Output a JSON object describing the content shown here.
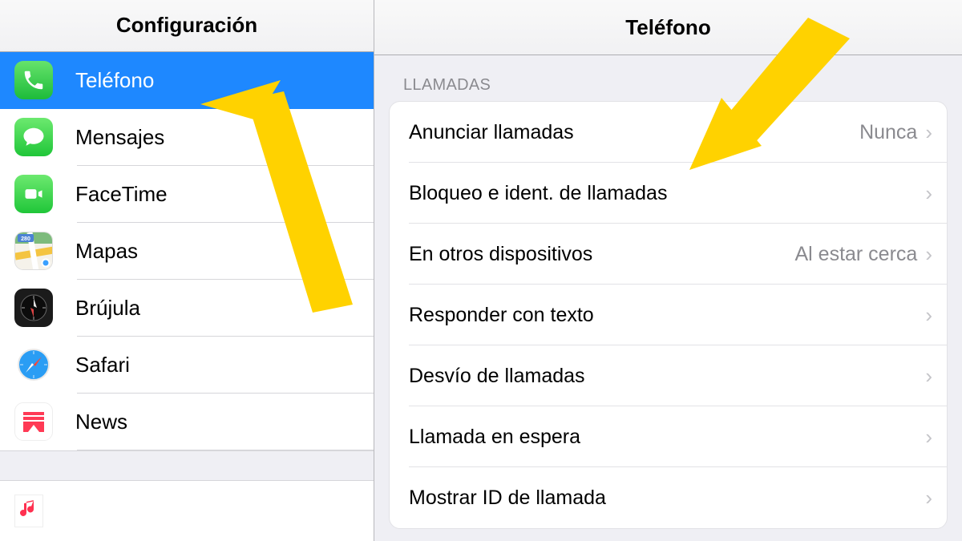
{
  "left": {
    "header": "Configuración",
    "items": [
      {
        "icon": "phone",
        "label": "Teléfono",
        "selected": true
      },
      {
        "icon": "messages",
        "label": "Mensajes"
      },
      {
        "icon": "facetime",
        "label": "FaceTime"
      },
      {
        "icon": "maps",
        "label": "Mapas"
      },
      {
        "icon": "compass",
        "label": "Brújula"
      },
      {
        "icon": "safari",
        "label": "Safari"
      },
      {
        "icon": "news",
        "label": "News"
      }
    ]
  },
  "right": {
    "header": "Teléfono",
    "section_label": "LLAMADAS",
    "rows": [
      {
        "label": "Anunciar llamadas",
        "value": "Nunca"
      },
      {
        "label": "Bloqueo e ident. de llamadas",
        "value": ""
      },
      {
        "label": "En otros dispositivos",
        "value": "Al estar cerca"
      },
      {
        "label": "Responder con texto",
        "value": ""
      },
      {
        "label": "Desvío de llamadas",
        "value": ""
      },
      {
        "label": "Llamada en espera",
        "value": ""
      },
      {
        "label": "Mostrar ID de llamada",
        "value": ""
      }
    ]
  },
  "colors": {
    "selection": "#1e88ff",
    "arrow": "#ffd200"
  }
}
